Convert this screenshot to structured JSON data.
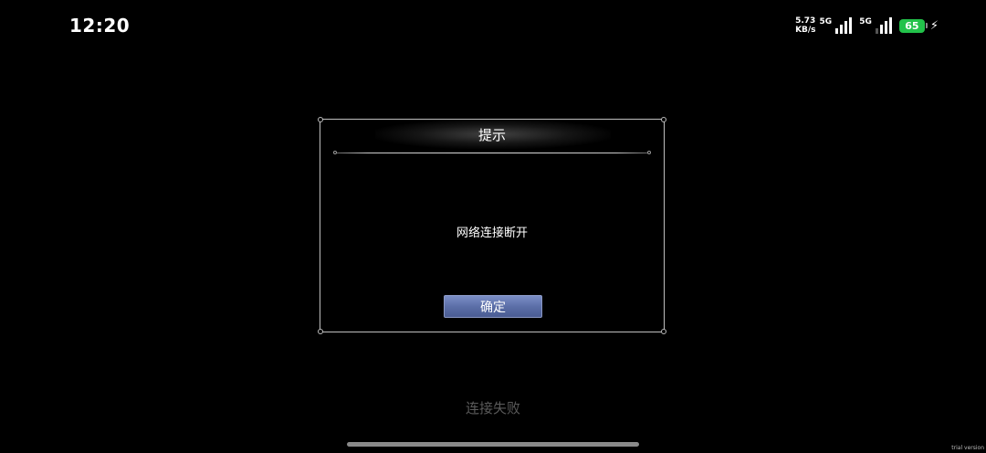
{
  "status_bar": {
    "time": "12:20",
    "speed_value": "5.73",
    "speed_unit": "KB/s",
    "net1": "5G",
    "net2": "5G",
    "battery": "65"
  },
  "dialog": {
    "title": "提示",
    "message": "网络连接断开",
    "confirm_label": "确定"
  },
  "footer": {
    "status_text": "连接失败",
    "watermark": "trial version"
  },
  "colors": {
    "battery": "#22c24a",
    "button": "#5c6fa8"
  }
}
